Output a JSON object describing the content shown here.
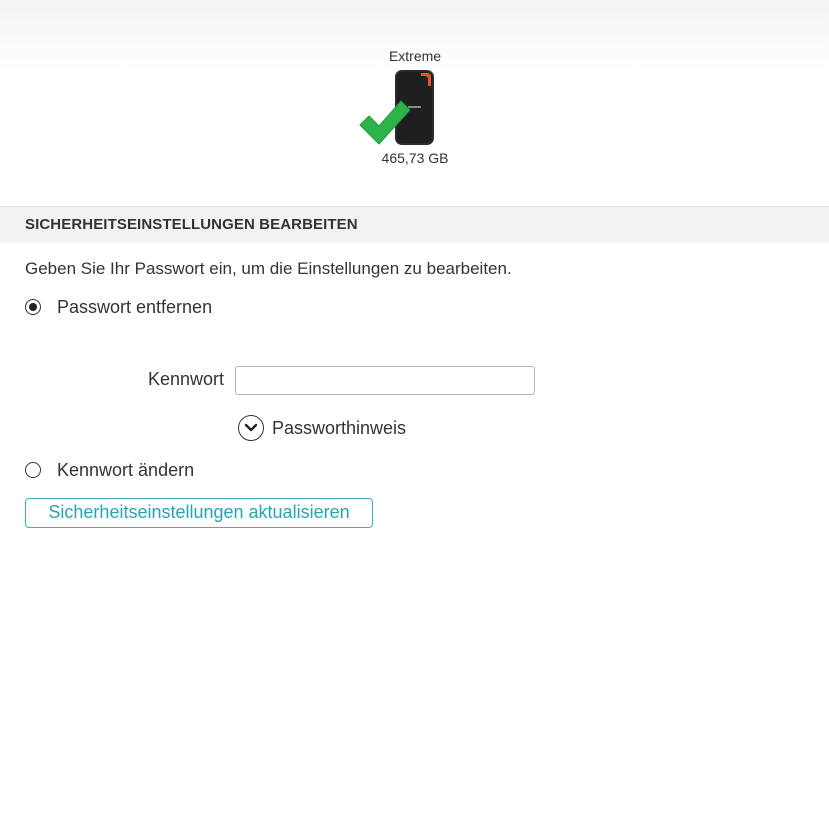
{
  "drive": {
    "name": "Extreme",
    "size": "465,73 GB",
    "status_icon": "checkmark-icon",
    "status_color": "#2db34a"
  },
  "section": {
    "title": "SICHERHEITSEINSTELLUNGEN BEARBEITEN",
    "instruction": "Geben Sie Ihr Passwort ein, um die Einstellungen zu bearbeiten."
  },
  "options": {
    "remove_password": {
      "label": "Passwort entfernen",
      "selected": true
    },
    "change_password": {
      "label": "Kennwort ändern",
      "selected": false
    }
  },
  "password_field": {
    "label": "Kennwort",
    "value": "",
    "placeholder": ""
  },
  "hint": {
    "label": "Passworthinweis",
    "icon": "chevron-down-circle-icon"
  },
  "update_button": {
    "label": "Sicherheitseinstellungen aktualisieren",
    "accent_color": "#3cb3c0"
  }
}
